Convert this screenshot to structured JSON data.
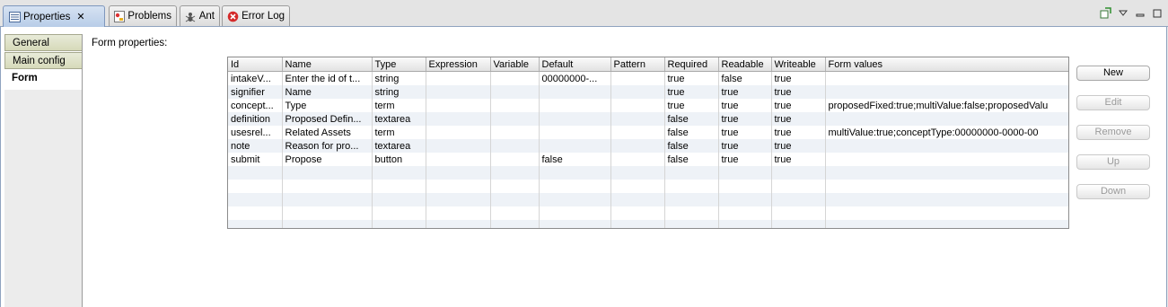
{
  "tabs": [
    {
      "label": "Properties",
      "icon": "properties-icon",
      "active": true,
      "closable": true
    },
    {
      "label": "Problems",
      "icon": "problems-icon"
    },
    {
      "label": "Ant",
      "icon": "ant-icon"
    },
    {
      "label": "Error Log",
      "icon": "error-log-icon"
    }
  ],
  "view_controls": [
    "pin-icon",
    "view-menu-icon",
    "minimize-icon",
    "maximize-icon"
  ],
  "sidebar": {
    "items": [
      {
        "label": "General"
      },
      {
        "label": "Main config"
      },
      {
        "label": "Form",
        "selected": true
      }
    ]
  },
  "form": {
    "label": "Form properties:",
    "columns": [
      "Id",
      "Name",
      "Type",
      "Expression",
      "Variable",
      "Default",
      "Pattern",
      "Required",
      "Readable",
      "Writeable",
      "Form values"
    ],
    "rows": [
      [
        "intakeV...",
        "Enter the id of t...",
        "string",
        "",
        "",
        "00000000-...",
        "",
        "true",
        "false",
        "true",
        ""
      ],
      [
        "signifier",
        "Name",
        "string",
        "",
        "",
        "",
        "",
        "true",
        "true",
        "true",
        ""
      ],
      [
        "concept...",
        "Type",
        "term",
        "",
        "",
        "",
        "",
        "true",
        "true",
        "true",
        "proposedFixed:true;multiValue:false;proposedValu"
      ],
      [
        "definition",
        "Proposed Defin...",
        "textarea",
        "",
        "",
        "",
        "",
        "false",
        "true",
        "true",
        ""
      ],
      [
        "usesrel...",
        "Related Assets",
        "term",
        "",
        "",
        "",
        "",
        "false",
        "true",
        "true",
        "multiValue:true;conceptType:00000000-0000-00"
      ],
      [
        "note",
        "Reason for pro...",
        "textarea",
        "",
        "",
        "",
        "",
        "false",
        "true",
        "true",
        ""
      ],
      [
        "submit",
        "Propose",
        "button",
        "",
        "",
        "false",
        "",
        "false",
        "true",
        "true",
        ""
      ]
    ]
  },
  "buttons": {
    "new": "New",
    "edit": "Edit",
    "remove": "Remove",
    "up": "Up",
    "down": "Down"
  }
}
